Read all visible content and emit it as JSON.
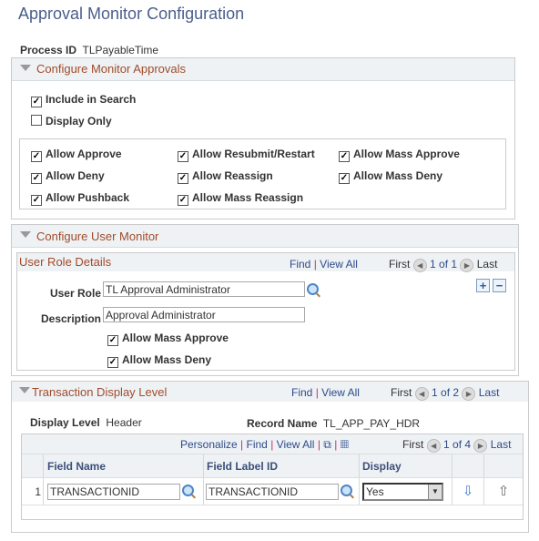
{
  "page": {
    "title": "Approval Monitor Configuration",
    "process_id_label": "Process ID",
    "process_id_value": "TLPayableTime"
  },
  "monitor_approvals": {
    "title": "Configure Monitor Approvals",
    "include_in_search": {
      "label": "Include in Search",
      "checked": true
    },
    "display_only": {
      "label": "Display Only",
      "checked": false
    },
    "options": [
      {
        "label": "Allow Approve",
        "checked": true
      },
      {
        "label": "Allow Resubmit/Restart",
        "checked": true
      },
      {
        "label": "Allow Mass Approve",
        "checked": true
      },
      {
        "label": "Allow Deny",
        "checked": true
      },
      {
        "label": "Allow Reassign",
        "checked": true
      },
      {
        "label": "Allow Mass Deny",
        "checked": true
      },
      {
        "label": "Allow Pushback",
        "checked": true
      },
      {
        "label": "Allow Mass Reassign",
        "checked": true
      }
    ]
  },
  "user_monitor": {
    "title": "Configure User Monitor",
    "role_details": {
      "title": "User Role Details",
      "find": "Find",
      "view_all": "View All",
      "first": "First",
      "count": "1 of 1",
      "last": "Last",
      "user_role_label": "User Role",
      "user_role_value": "TL Approval Administrator",
      "description_label": "Description",
      "description_value": "Approval Administrator",
      "mass_approve": {
        "label": "Allow Mass Approve",
        "checked": true
      },
      "mass_deny": {
        "label": "Allow Mass Deny",
        "checked": true
      },
      "add": "+",
      "remove": "−"
    }
  },
  "transaction": {
    "title": "Transaction Display Level",
    "find": "Find",
    "view_all": "View All",
    "first": "First",
    "count": "1 of 2",
    "last": "Last",
    "display_level_label": "Display Level",
    "display_level_value": "Header",
    "record_name_label": "Record Name",
    "record_name_value": "TL_APP_PAY_HDR",
    "grid": {
      "personalize": "Personalize",
      "find": "Find",
      "view_all": "View All",
      "first": "First",
      "count": "1 of 4",
      "last": "Last",
      "columns": [
        "Field Name",
        "Field Label ID",
        "Display"
      ],
      "rows": [
        {
          "num": "1",
          "field_name": "TRANSACTIONID",
          "field_label_id": "TRANSACTIONID",
          "display": "Yes"
        }
      ]
    }
  }
}
